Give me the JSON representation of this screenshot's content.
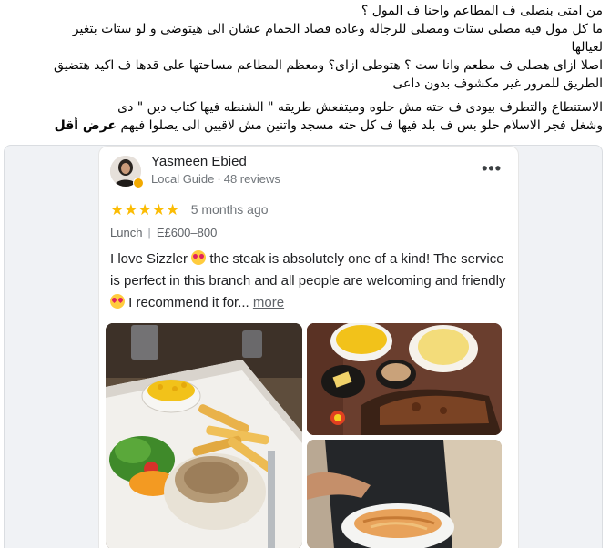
{
  "post": {
    "lines": [
      "من امتى بنصلى ف المطاعم واحنا ف المول ؟",
      "ما كل مول فيه مصلى  ستات ومصلى للرجاله  وعاده قصاد الحمام عشان الى هيتوضى و لو ستات بتغير",
      "لعيالها",
      "اصلا ازاى هصلى ف مطعم وانا ست ؟ هتوطى ازاى؟ ومعظم المطاعم مساحتها على قدها ف اكيد هتضيق",
      "الطريق للمرور غير مكشوف بدون داعى",
      "الاستنطاع والتطرف بيودى ف حته مش حلوه وميتفعش طريقه \" الشنطه فيها كتاب دين \" دى",
      "وشغل فجر الاسلام حلو بس ف بلد فيها ف كل حته مسجد واتنين  مش لاقيين الى يصلوا فيهم"
    ],
    "see_less": "عرض أقل"
  },
  "review": {
    "name": "Yasmeen Ebied",
    "role": "Local Guide",
    "reviews": "48 reviews",
    "dot": "·",
    "more_menu": "•••",
    "star": "★",
    "rating": 5,
    "time": "5 months ago",
    "meal": "Lunch",
    "meta_sep": "|",
    "price": "E£600–800",
    "text_1": "I love Sizzler ",
    "text_2": " the steak is absolutely one of a kind! The service is perfect in this branch and all people are welcoming and friendly ",
    "text_3": " I recommend it for...",
    "more": "more"
  },
  "colors": {
    "star": "#fbbc04",
    "link": "#5f6368",
    "guide_badge": "#f2a900"
  }
}
